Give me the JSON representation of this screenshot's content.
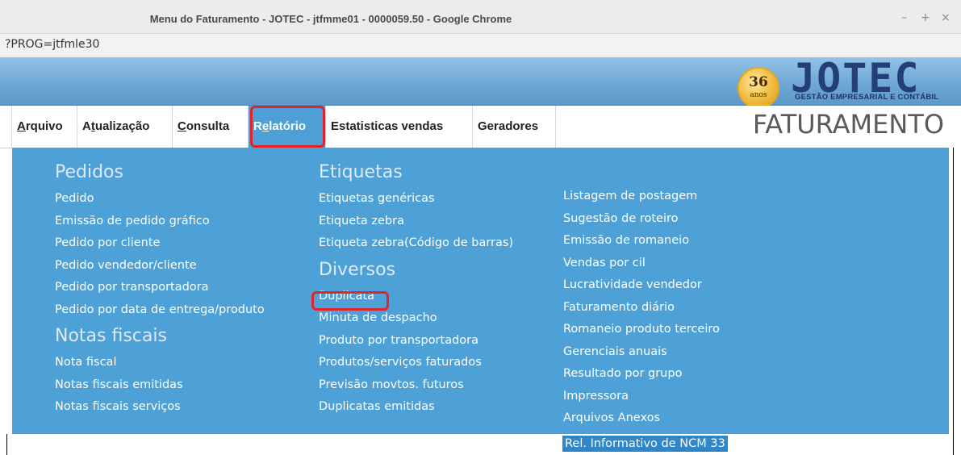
{
  "window": {
    "title": "Menu do Faturamento - JOTEC - jtfmme01 - 0000059.50 - Google Chrome",
    "url_fragment": "?PROG=jtfmle30",
    "controls": {
      "minimize": "–",
      "maximize": "+",
      "close": "×"
    }
  },
  "header": {
    "badge_number": "36",
    "badge_text": "anos",
    "brand": "JOTEC",
    "tagline": "GESTÃO EMPRESARIAL E CONTÁBIL",
    "module_title": "FATURAMENTO"
  },
  "menubar": {
    "items": [
      {
        "pre": "",
        "u": "A",
        "post": "rquivo"
      },
      {
        "pre": "A",
        "u": "t",
        "post": "ualização"
      },
      {
        "pre": "",
        "u": "C",
        "post": "onsulta"
      },
      {
        "pre": "R",
        "u": "e",
        "post": "latório"
      },
      {
        "pre": "",
        "u": "",
        "post": "Estatisticas vendas"
      },
      {
        "pre": "",
        "u": "",
        "post": "Geradores"
      }
    ],
    "active_index": 3
  },
  "dropdown": {
    "col1": {
      "sections": [
        {
          "title": "Pedidos",
          "items": [
            "Pedido",
            "Emissão de pedido gráfico",
            "Pedido por cliente",
            "Pedido vendedor/cliente",
            "Pedido por transportadora",
            "Pedido por data de entrega/produto"
          ]
        },
        {
          "title": "Notas fiscais",
          "items": [
            "Nota fiscal",
            "Notas fiscais emitidas",
            "Notas fiscais serviços"
          ]
        }
      ]
    },
    "col2": {
      "sections": [
        {
          "title": "Etiquetas",
          "items": [
            "Etiquetas genéricas",
            "Etiqueta zebra",
            "Etiqueta zebra(Código de barras)"
          ]
        },
        {
          "title": "Diversos",
          "items": [
            "Duplicata",
            "Minuta de despacho",
            "Produto por transportadora",
            "Produtos/serviços faturados",
            "Previsão movtos. futuros",
            "Duplicatas emitidas"
          ]
        }
      ]
    },
    "col3": {
      "items": [
        "Listagem de postagem",
        "Sugestão de roteiro",
        "Emissão de romaneio",
        "Vendas por cil",
        "Lucratividade vendedor",
        "Faturamento diário",
        "Romaneio produto terceiro",
        "Gerenciais anuais",
        "Resultado por grupo",
        "Impressora",
        "Arquivos Anexos"
      ]
    },
    "selected_item": "Rel. Informativo de NCM 33"
  },
  "accent_colors": {
    "menu_panel": "#4da1d7",
    "highlight_box": "#e2232e",
    "header_gradient_top": "#93c3e6",
    "header_gradient_bottom": "#5d98c9"
  }
}
